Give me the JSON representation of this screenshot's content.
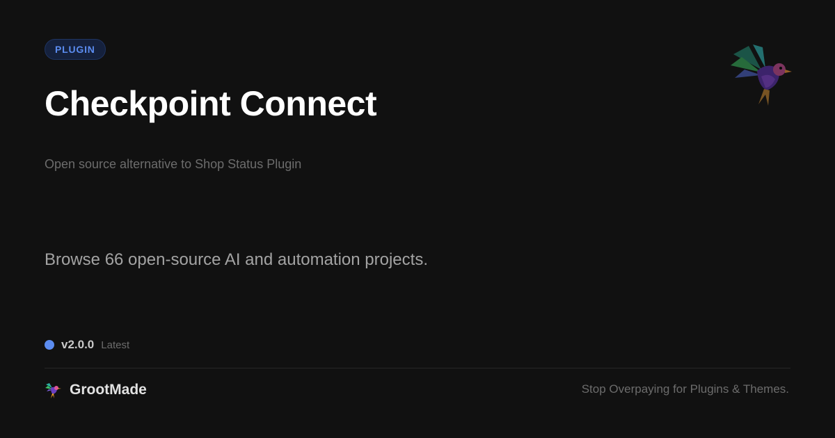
{
  "badge": {
    "label": "PLUGIN"
  },
  "title": "Checkpoint Connect",
  "subtitle": "Open source alternative  to Shop Status Plugin",
  "tagline": "Browse  66 open-source  AI and automation  projects.",
  "version": {
    "number": "v2.0.0",
    "tag": "Latest"
  },
  "footer": {
    "brand_name": "GrootMade",
    "slogan": "Stop Overpaying  for Plugins & Themes."
  },
  "colors": {
    "background": "#111111",
    "accent": "#5b8cf0",
    "badge_bg": "#15213d",
    "muted_text": "#6c6c6c",
    "divider": "#262626"
  },
  "icons": {
    "badge_dot": "status-dot",
    "brand_logo": "hummingbird-logo-icon",
    "decoration": "hummingbird-illustration-icon"
  }
}
